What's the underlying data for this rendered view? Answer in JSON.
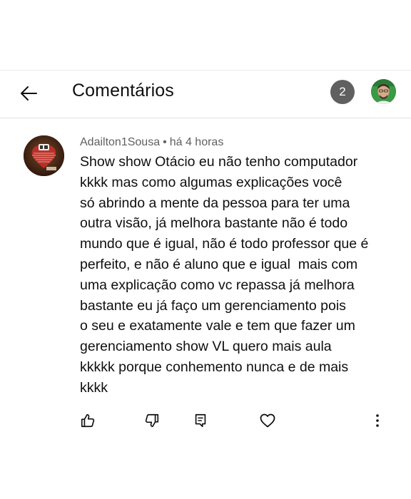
{
  "header": {
    "title": "Comentários",
    "comment_count": "2",
    "back_icon": "arrow-left-icon",
    "avatar_icon": "user-avatar"
  },
  "comment": {
    "author": "Adailton1Sousa",
    "separator": "•",
    "time": "há 4 horas",
    "lines": [
      "Show show Otácio eu não tenho computador",
      "kkkk mas como algumas explicações você",
      "só abrindo a mente da pessoa para ter uma",
      "outra visão, já melhora bastante não é todo",
      "mundo que é igual, não é todo professor que é",
      "perfeito, e não é aluno que e igual  mais com",
      "uma explicação como vc repassa já melhora",
      "bastante eu já faço um gerenciamento pois",
      "o seu e exatamente vale e tem que fazer um",
      "gerenciamento show VL quero mais aula",
      "kkkkk porque conhemento nunca e de mais",
      "kkkk"
    ],
    "actions": {
      "like_icon": "thumbs-up-icon",
      "dislike_icon": "thumbs-down-icon",
      "reply_icon": "reply-icon",
      "heart_icon": "heart-icon",
      "menu_icon": "more-vertical-icon"
    }
  },
  "colors": {
    "text_primary": "#0f0f0f",
    "text_secondary": "#606060",
    "badge_bg": "#606060",
    "divider": "#e2e2e2"
  }
}
